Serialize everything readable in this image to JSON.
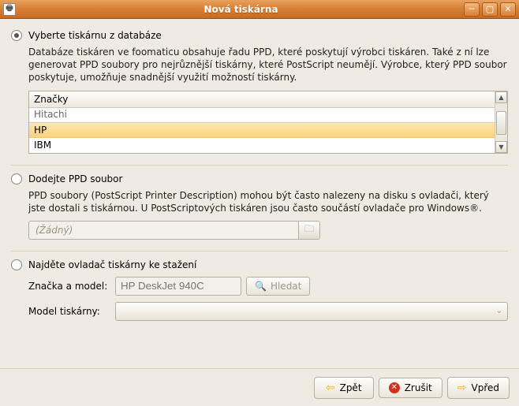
{
  "window": {
    "title": "Nová tiskárna"
  },
  "option1": {
    "label": "Vyberte tiskárnu z databáze",
    "description": "Databáze tiskáren ve foomaticu obsahuje řadu PPD, které poskytují výrobci tiskáren. Také z ní lze generovat PPD soubory pro nejrůznější tiskárny, které PostScript neumějí. Výrobce, který PPD soubor poskytuje, umožňuje snadnější využití možností tiskárny.",
    "list_header": "Značky",
    "items": [
      "Hitachi",
      "HP",
      "IBM"
    ],
    "selected_index": 1
  },
  "option2": {
    "label": "Dodejte PPD soubor",
    "description": "PPD soubory (PostScript Printer Description) mohou být často nalezeny na disku s ovladači, který jste dostali s tiskárnou. U PostScriptových tiskáren jsou často součástí ovladače pro Windows®.",
    "file_placeholder": "(Žádný)"
  },
  "option3": {
    "label": "Najděte ovladač tiskárny ke stažení",
    "brand_label": "Značka a model:",
    "brand_placeholder": "HP DeskJet 940C",
    "search_button": "Hledat",
    "model_label": "Model tiskárny:"
  },
  "footer": {
    "back": "Zpět",
    "cancel": "Zrušit",
    "forward": "Vpřed"
  }
}
